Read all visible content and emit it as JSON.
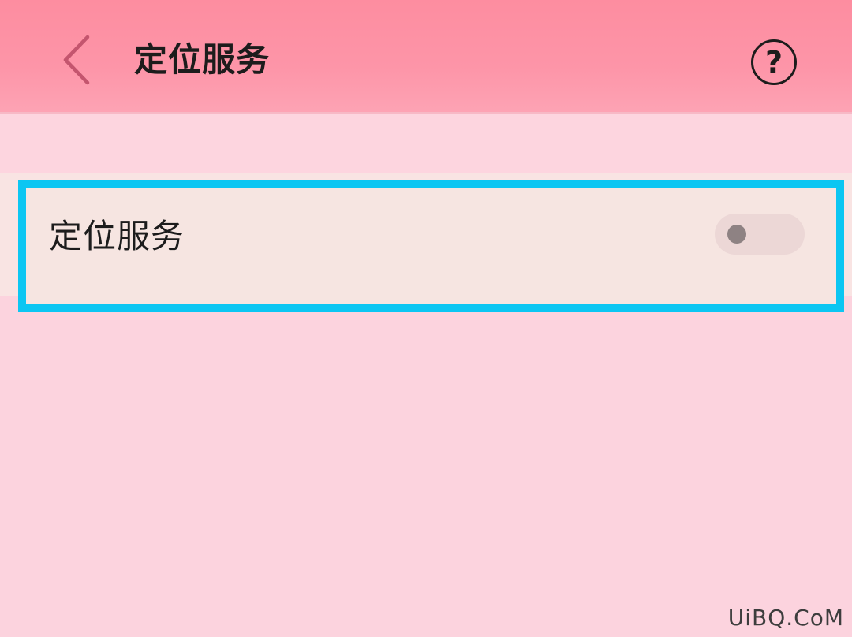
{
  "app_bar": {
    "title": "定位服务",
    "back_icon": "chevron-left-icon",
    "help_icon": "question-circle-icon",
    "help_glyph": "?"
  },
  "settings": {
    "rows": [
      {
        "label": "定位服务",
        "toggle_on": false
      }
    ]
  },
  "colors": {
    "app_bar": "#fd8da0",
    "background": "#fcd3de",
    "row_background": "#f9e4e3",
    "highlight": "#0cc6f2",
    "back_chevron": "#c4556e",
    "toggle_track": "#ecd7d6",
    "toggle_knob": "#8e8283"
  },
  "watermark": {
    "text": "UiBQ.CoM"
  }
}
